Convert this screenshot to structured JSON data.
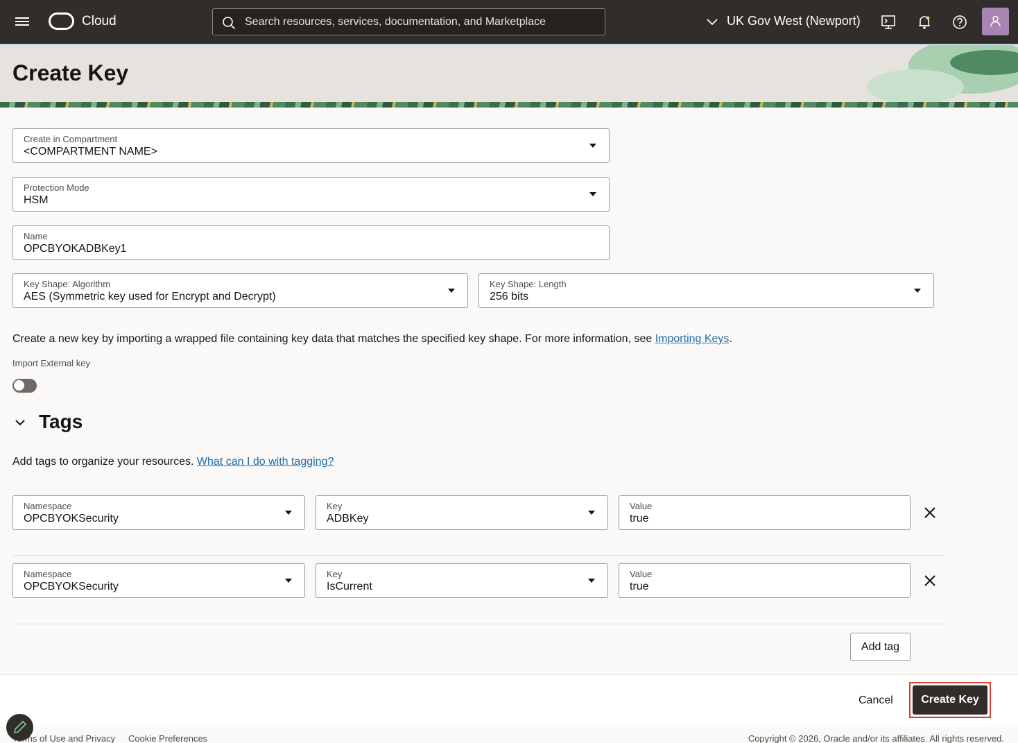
{
  "topbar": {
    "brand": "Cloud",
    "search_placeholder": "Search resources, services, documentation, and Marketplace",
    "region": "UK Gov West (Newport)",
    "icons": [
      "menu-icon",
      "cloud-logo",
      "search-icon",
      "chevron-down-icon",
      "cloud-shell-icon",
      "bell-icon",
      "help-icon",
      "user-icon"
    ]
  },
  "page": {
    "title": "Create Key"
  },
  "form": {
    "compartment": {
      "label": "Create in Compartment",
      "value": "<COMPARTMENT NAME>"
    },
    "protection_mode": {
      "label": "Protection Mode",
      "value": "HSM"
    },
    "name": {
      "label": "Name",
      "value": "OPCBYOKADBKey1"
    },
    "algorithm": {
      "label": "Key Shape: Algorithm",
      "value": "AES (Symmetric key used for Encrypt and Decrypt)"
    },
    "length": {
      "label": "Key Shape: Length",
      "value": "256 bits"
    },
    "import_info": "Create a new key by importing a wrapped file containing key data that matches the specified key shape. For more information, see ",
    "import_link": "Importing Keys",
    "import_toggle_label": "Import External key",
    "import_toggle_on": false
  },
  "tags": {
    "title": "Tags",
    "description": "Add tags to organize your resources. ",
    "help_link": "What can I do with tagging?",
    "rows": [
      {
        "namespace_label": "Namespace",
        "namespace": "OPCBYOKSecurity",
        "key_label": "Key",
        "key": "ADBKey",
        "value_label": "Value",
        "value": "true"
      },
      {
        "namespace_label": "Namespace",
        "namespace": "OPCBYOKSecurity",
        "key_label": "Key",
        "key": "IsCurrent",
        "value_label": "Value",
        "value": "true"
      }
    ],
    "add_label": "Add tag"
  },
  "actions": {
    "cancel": "Cancel",
    "create": "Create Key"
  },
  "footer": {
    "terms": "Terms of Use and Privacy",
    "cookies": "Cookie Preferences",
    "copyright": "Copyright © 2026, Oracle and/or its affiliates. All rights reserved."
  },
  "colors": {
    "topbar": "#312d2a",
    "link": "#1f6ba3",
    "highlight": "#e03b2e"
  }
}
